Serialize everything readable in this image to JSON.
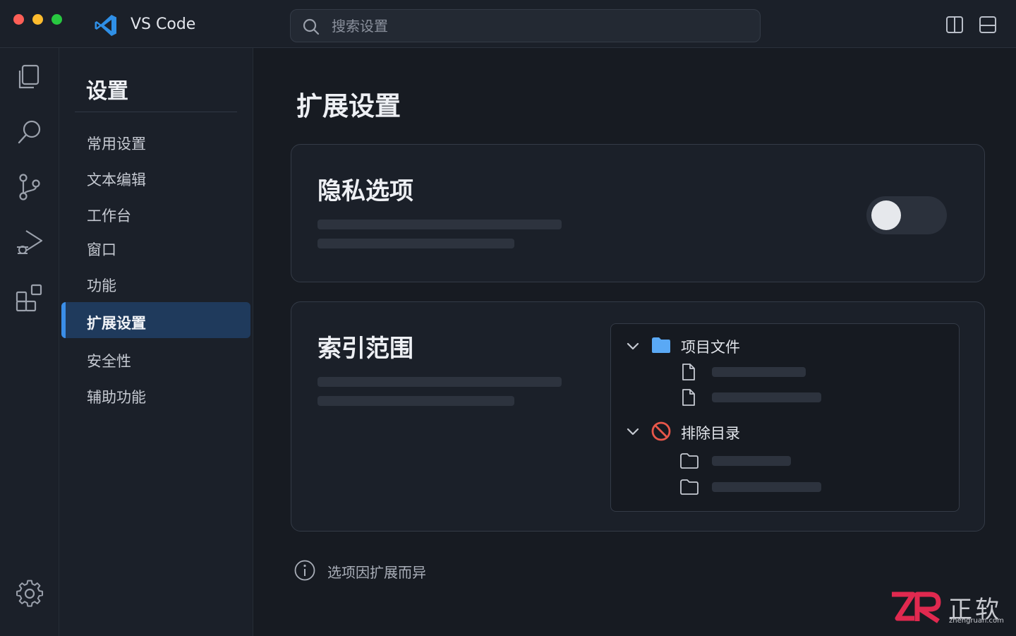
{
  "window": {
    "app_title": "VS Code"
  },
  "search": {
    "placeholder": "搜索设置"
  },
  "activity_bar": {
    "items": [
      "explorer-icon",
      "search-icon",
      "source-control-icon",
      "run-debug-icon",
      "extensions-icon"
    ],
    "bottom": "gear-icon"
  },
  "sidebar": {
    "title": "设置",
    "items": [
      {
        "label": "常用设置"
      },
      {
        "label": "文本编辑"
      },
      {
        "label": "工作台"
      },
      {
        "label": "窗口"
      },
      {
        "label": "功能"
      },
      {
        "label": "扩展设置",
        "active": true
      },
      {
        "label": "安全性"
      },
      {
        "label": "辅助功能"
      }
    ]
  },
  "main": {
    "page_title": "扩展设置",
    "privacy_card": {
      "title": "隐私选项",
      "toggle_on": false
    },
    "index_card": {
      "title": "索引范围",
      "tree": {
        "groups": [
          {
            "label": "项目文件",
            "icon": "folder-icon",
            "expanded": true,
            "children": [
              "file-icon",
              "file-icon"
            ]
          },
          {
            "label": "排除目录",
            "icon": "no-entry-icon",
            "expanded": true,
            "children": [
              "folder-outline-icon",
              "folder-outline-icon"
            ]
          }
        ]
      }
    },
    "footer_note": "选项因扩展而异"
  },
  "watermark": {
    "logo_text": "ZR",
    "text": "正软",
    "sub": "zhengruan.com"
  },
  "colors": {
    "accent": "#3b8ee8",
    "active_bg": "#1f3a5c",
    "background": "#171b22",
    "panel": "#1b2029",
    "folder": "#5aa9f5",
    "danger": "#e8574a",
    "watermark_red": "#e0294f"
  }
}
